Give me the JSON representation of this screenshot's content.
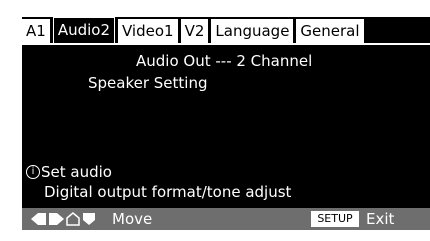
{
  "tabs": [
    "A1",
    "Audio2",
    "Video1",
    "V2",
    "Language",
    "General"
  ],
  "active_tab": "Audio2",
  "content": {
    "audio_out": "Audio Out --- 2 Channel",
    "speaker_setting": "Speaker Setting"
  },
  "info": {
    "icon": "info-icon",
    "icon_glyph": "i",
    "line1": "Set audio",
    "line2": "Digital output format/tone adjust"
  },
  "bottom_bar": {
    "nav_icons": [
      "arrow-left-icon",
      "arrow-right-icon",
      "arrow-up-icon",
      "arrow-down-icon"
    ],
    "move_label": "Move",
    "setup_key": "SETUP",
    "exit_label": "Exit"
  },
  "colors": {
    "screen_bg": "#000000",
    "tab_bg": "#ffffff",
    "bottom_bar_bg": "#6e6e6e"
  }
}
